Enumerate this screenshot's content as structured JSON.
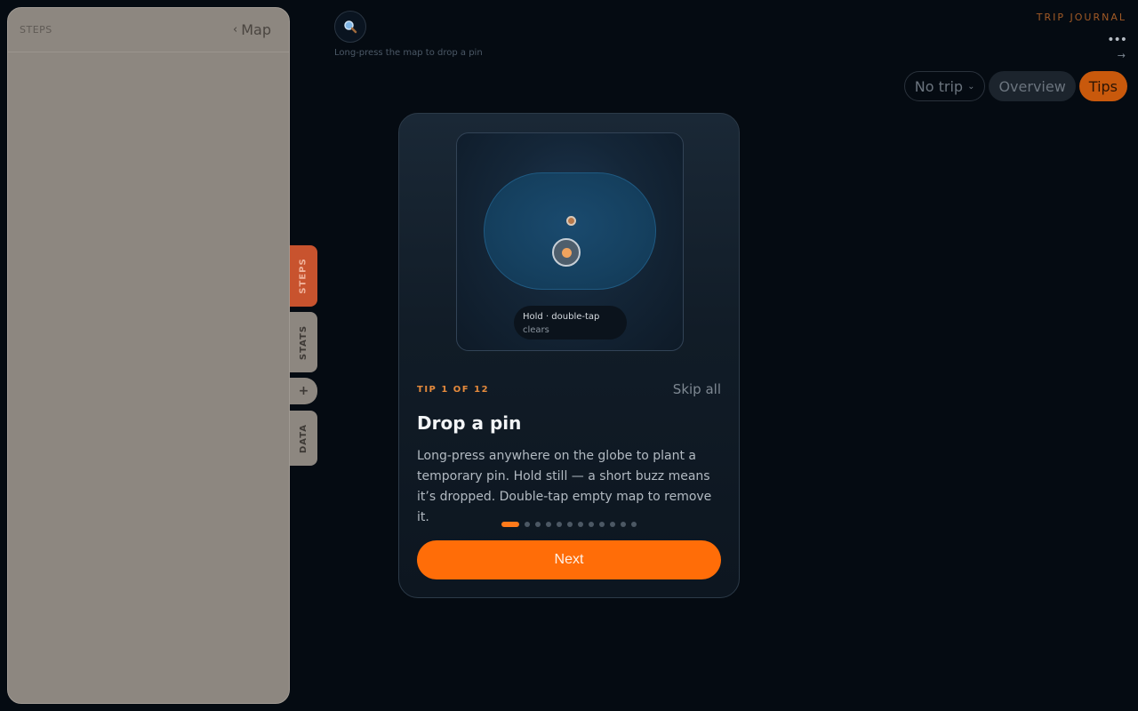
{
  "side_panel": {
    "title": "STEPS",
    "map_link": "Map",
    "back_chevron": "‹"
  },
  "side_tabs": [
    {
      "label": "STEPS",
      "active": true
    },
    {
      "label": "STATS",
      "active": false
    },
    {
      "label": "+",
      "active": false
    },
    {
      "label": "DATA",
      "active": false
    }
  ],
  "search": {
    "icon": "search-icon",
    "hint": "Long-press the map to drop a pin"
  },
  "header": {
    "brand": "TRIP JOURNAL",
    "more_icon": "•••",
    "arrow_icon": "→"
  },
  "top_controls": {
    "trip_select": "No trip",
    "trip_chevron": "⌄",
    "overview": "Overview",
    "tips": "Tips"
  },
  "tip_card": {
    "illustration": {
      "tooltip_line1": "Hold · double-tap",
      "tooltip_line2": "clears"
    },
    "counter": "TIP 1 OF 12",
    "skip_label": "Skip all",
    "title": "Drop a pin",
    "body": "Long-press anywhere on the globe to plant a temporary pin. Hold still — a short buzz means it’s dropped. Double-tap empty map to remove it.",
    "current_index": 1,
    "total": 12,
    "next_label": "Next"
  },
  "colors": {
    "accent": "#ff6d08",
    "background": "#050b12",
    "side_panel": "#8d8780",
    "steps_tab": "#c8532e"
  }
}
